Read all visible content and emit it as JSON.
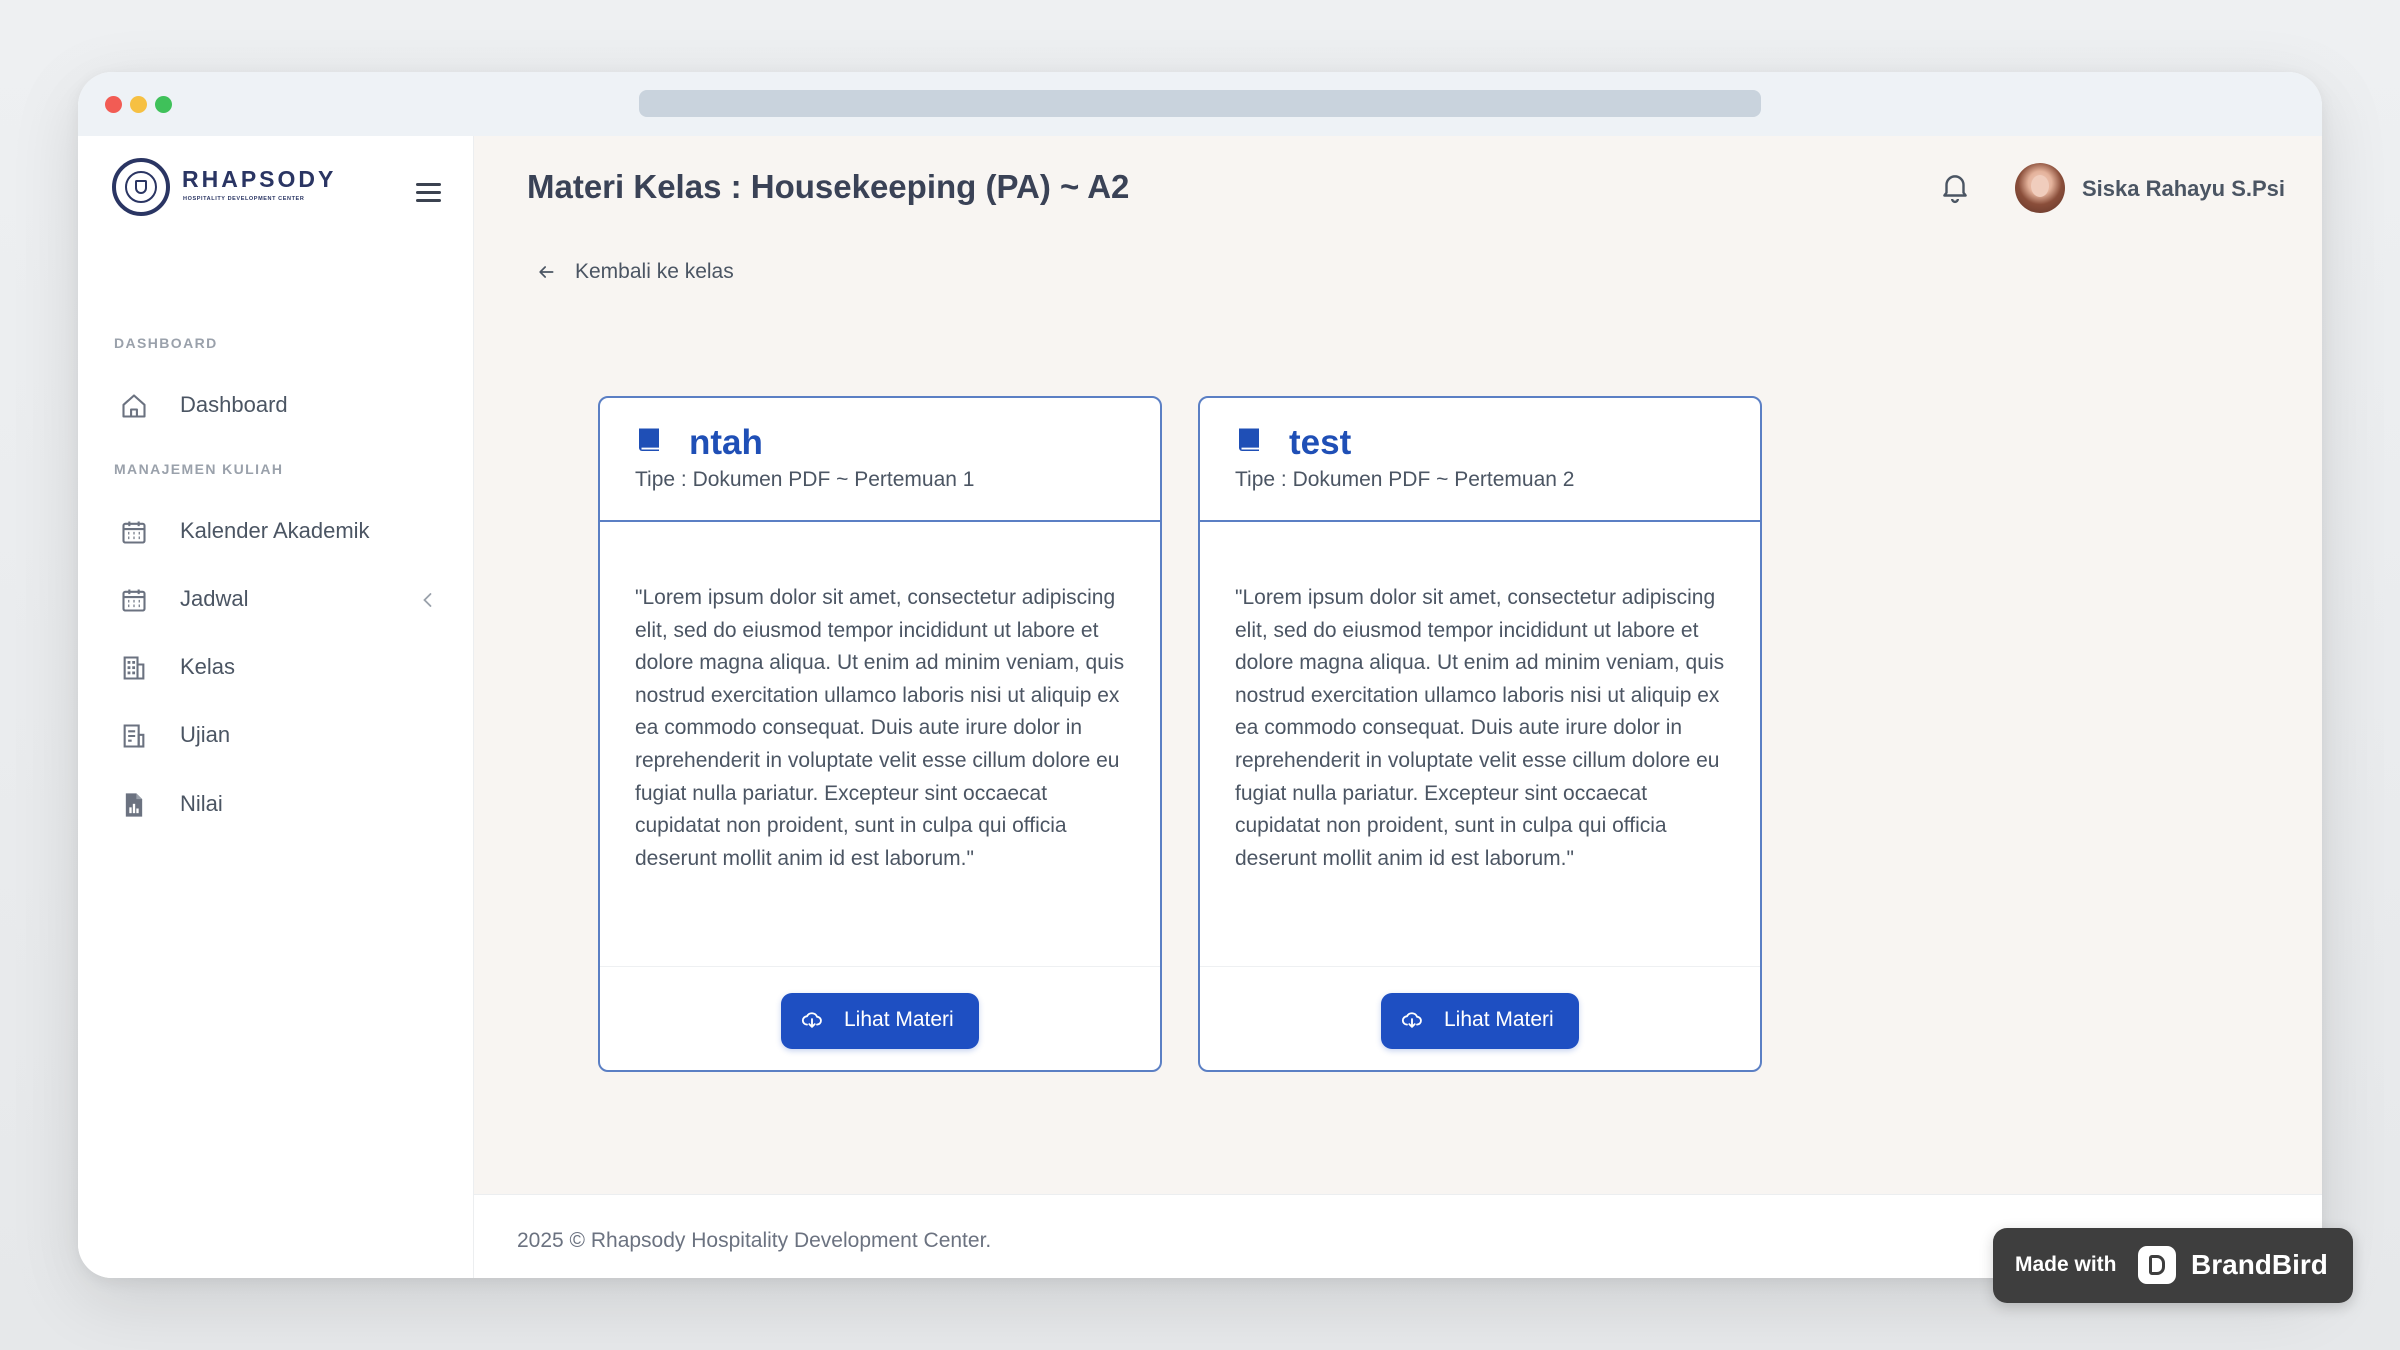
{
  "window": {
    "controls": [
      "close",
      "minimize",
      "zoom"
    ]
  },
  "sidebar": {
    "logo": {
      "name": "RHAPSODY",
      "tagline": "HOSPITALITY DEVELOPMENT CENTER"
    },
    "sections": [
      {
        "label": "DASHBOARD"
      },
      {
        "label": "MANAJEMEN KULIAH"
      }
    ],
    "items": [
      {
        "label": "Dashboard",
        "icon": "home-icon"
      },
      {
        "label": "Kalender Akademik",
        "icon": "calendar-icon"
      },
      {
        "label": "Jadwal",
        "icon": "calendar-icon",
        "has_submenu": true
      },
      {
        "label": "Kelas",
        "icon": "building-icon"
      },
      {
        "label": "Ujian",
        "icon": "exam-icon"
      },
      {
        "label": "Nilai",
        "icon": "grade-report-icon"
      }
    ]
  },
  "header": {
    "title": "Materi Kelas : Housekeeping (PA) ~ A2",
    "user_name": "Siska Rahayu S.Psi",
    "notification_icon": "bell-icon"
  },
  "back_link": {
    "label": "Kembali ke kelas"
  },
  "cards": [
    {
      "title": "ntah",
      "meta": "Tipe : Dokumen PDF ~ Pertemuan 1",
      "body": "\"Lorem ipsum dolor sit amet, consectetur adipiscing elit, sed do eiusmod tempor incididunt ut labore et dolore magna aliqua. Ut enim ad minim veniam, quis nostrud exercitation ullamco laboris nisi ut aliquip ex ea commodo consequat. Duis aute irure dolor in reprehenderit in voluptate velit esse cillum dolore eu fugiat nulla pariatur. Excepteur sint occaecat cupidatat non proident, sunt in culpa qui officia deserunt mollit anim id est laborum.\"",
      "button": "Lihat Materi"
    },
    {
      "title": "test",
      "meta": "Tipe : Dokumen PDF ~ Pertemuan 2",
      "body": "\"Lorem ipsum dolor sit amet, consectetur adipiscing elit, sed do eiusmod tempor incididunt ut labore et dolore magna aliqua. Ut enim ad minim veniam, quis nostrud exercitation ullamco laboris nisi ut aliquip ex ea commodo consequat. Duis aute irure dolor in reprehenderit in voluptate velit esse cillum dolore eu fugiat nulla pariatur. Excepteur sint occaecat cupidatat non proident, sunt in culpa qui officia deserunt mollit anim id est laborum.\"",
      "button": "Lihat Materi"
    }
  ],
  "footer": {
    "text": "2025 © Rhapsody Hospitality Development Center."
  },
  "badge": {
    "prefix": "Made with",
    "brand": "BrandBird"
  },
  "colors": {
    "primary": "#1e4fc2",
    "card_border": "#5b7fc4",
    "main_bg": "#f8f5f2",
    "brand_navy": "#2a3563"
  }
}
